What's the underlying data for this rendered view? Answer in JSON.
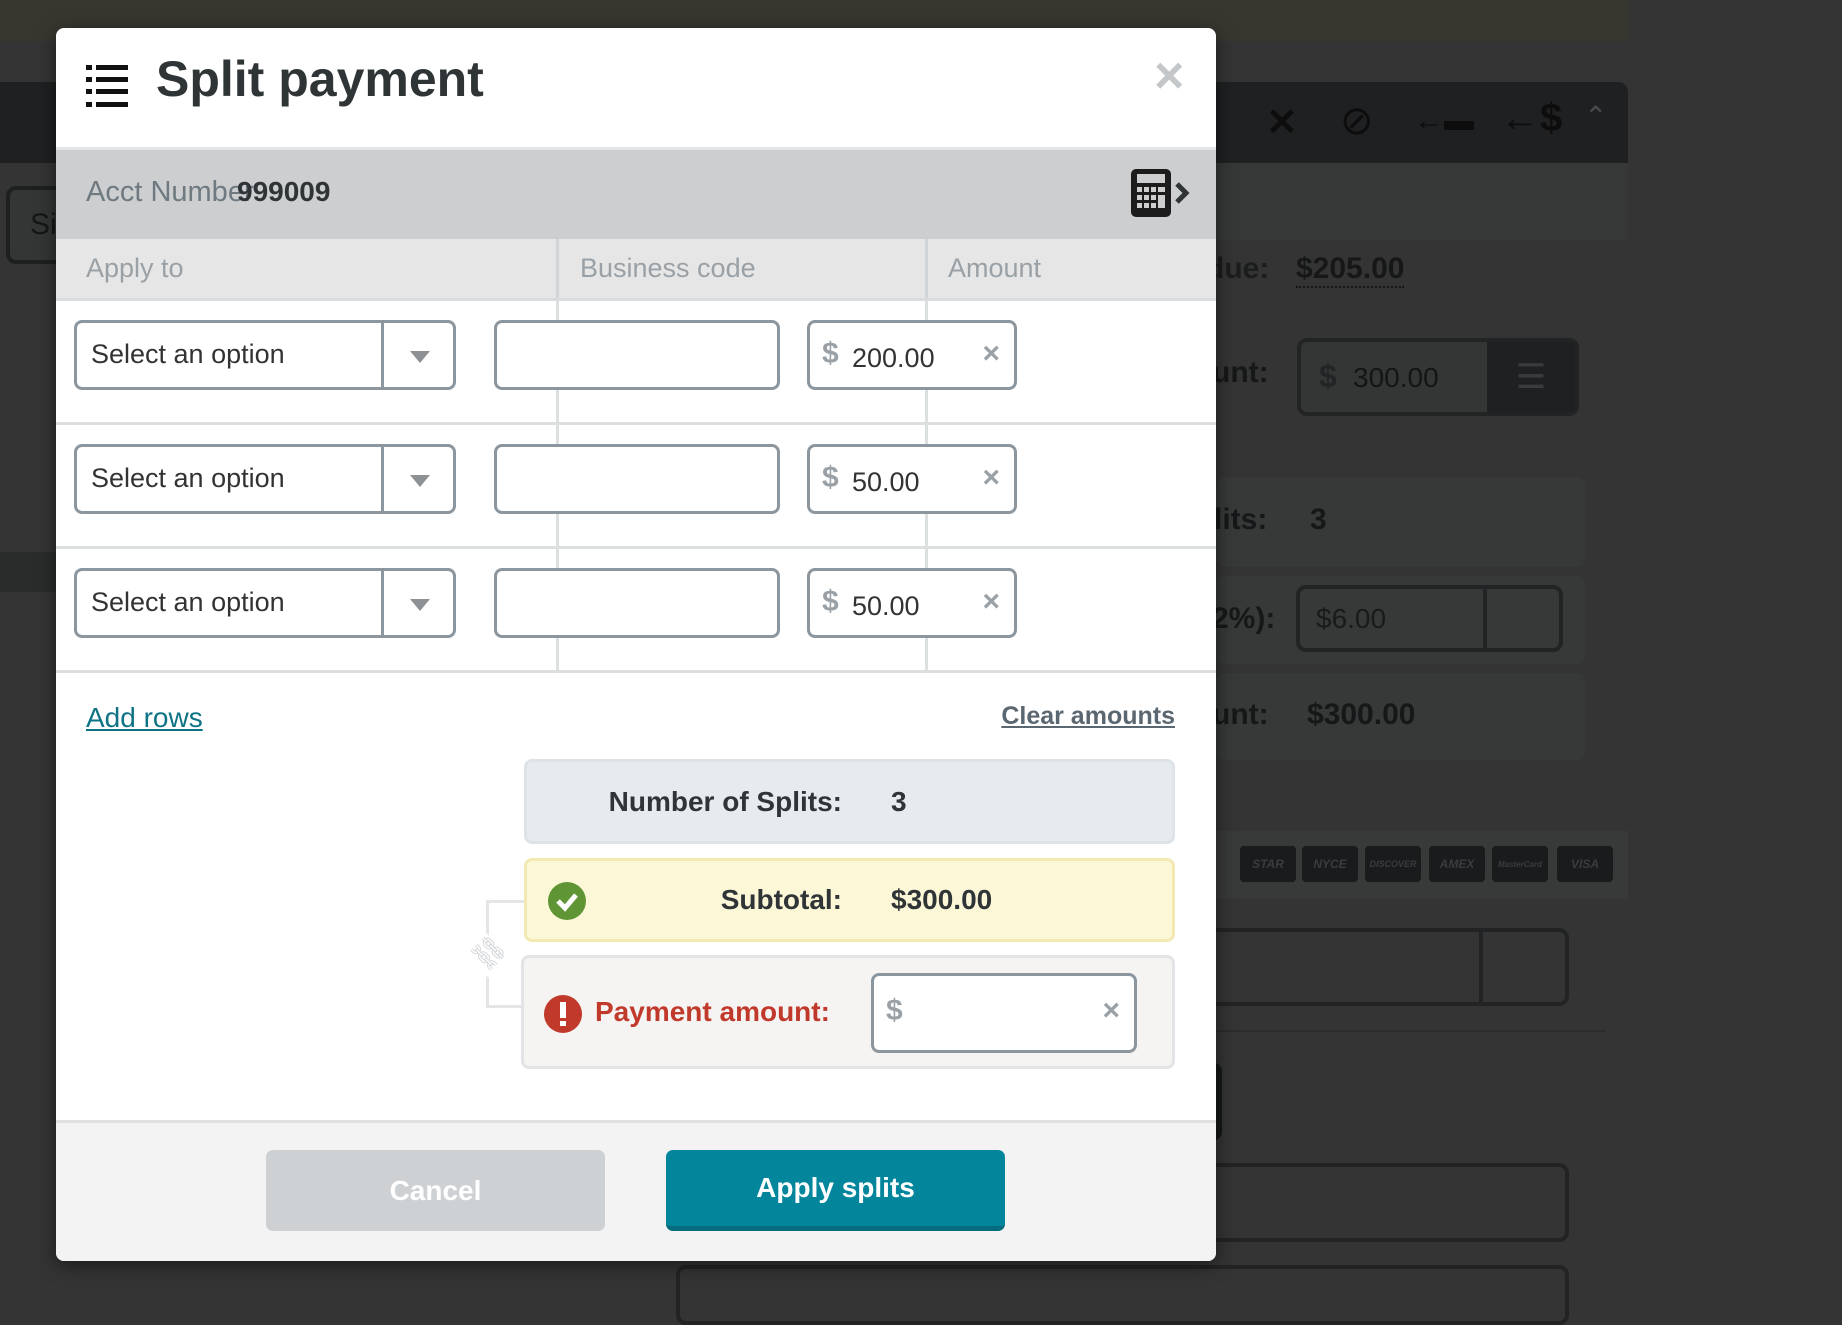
{
  "background": {
    "left_button": "Si",
    "due_label": "due:",
    "due_value": "$205.00",
    "amount_label": "unt:",
    "amount_currency": "$",
    "amount_value": "300.00",
    "splits_label": "lits:",
    "splits_value": "3",
    "fee_label": "2%):",
    "fee_value": "$6.00",
    "total_label": "unt:",
    "total_value": "$300.00",
    "cards": [
      "STAR",
      "NYCE",
      "DISCOVER",
      "AMEX",
      "MasterCard",
      "VISA"
    ]
  },
  "dialog": {
    "title": "Split payment",
    "close": "×",
    "acct_label": "Acct Number",
    "acct_value": "999009",
    "columns": [
      "Apply to",
      "Business code",
      "Amount"
    ],
    "rows": [
      {
        "apply_to": "Select an option",
        "business_code": "",
        "currency": "$",
        "amount": "200.00"
      },
      {
        "apply_to": "Select an option",
        "business_code": "",
        "currency": "$",
        "amount": "50.00"
      },
      {
        "apply_to": "Select an option",
        "business_code": "",
        "currency": "$",
        "amount": "50.00"
      }
    ],
    "add_rows": "Add rows",
    "clear_amounts": "Clear amounts",
    "splits_label": "Number of Splits:",
    "splits_value": "3",
    "subtotal_label": "Subtotal:",
    "subtotal_value": "$300.00",
    "payment_label": "Payment amount:",
    "payment_currency": "$",
    "payment_value": "",
    "cancel": "Cancel",
    "apply": "Apply splits",
    "colors": {
      "accent": "#03869c",
      "link": "#0e7485",
      "error": "#c0392b",
      "success": "#5f9535"
    }
  }
}
